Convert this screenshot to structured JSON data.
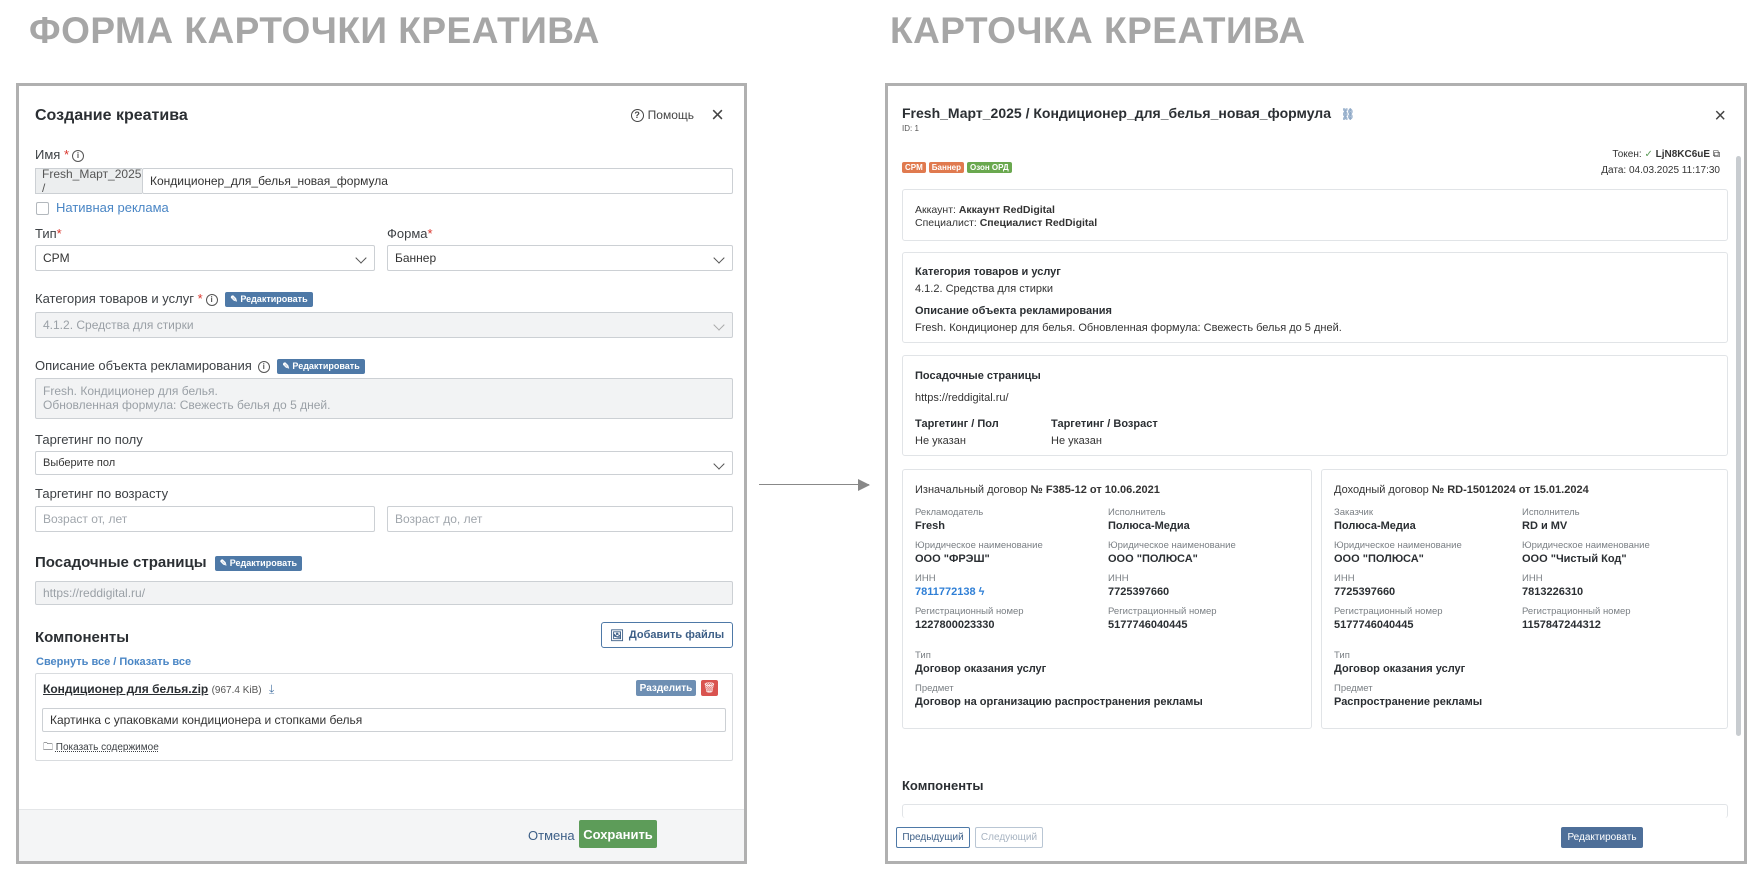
{
  "titles": {
    "form": "ФОРМА КАРТОЧКИ КРЕАТИВА",
    "card": "КАРТОЧКА КРЕАТИВА"
  },
  "form": {
    "title": "Создание креатива",
    "help": "Помощь",
    "name_label": "Имя",
    "name_prefix": "Fresh_Март_2025 /",
    "name_value": "Кондиционер_для_белья_новая_формула",
    "native_label": "Нативная реклама",
    "type_label": "Тип",
    "type_value": "CPM",
    "form_label": "Форма",
    "form_value": "Баннер",
    "category_label": "Категория товаров и услуг",
    "edit_badge": "Редактировать",
    "category_value": "4.1.2. Средства для стирки",
    "description_label": "Описание объекта рекламирования",
    "description_line1": "Fresh. Кондиционер для белья.",
    "description_line2": "Обновленная формула: Свежесть белья до 5 дней.",
    "gender_label": "Таргетинг по полу",
    "gender_placeholder": "Выберите пол",
    "age_label": "Таргетинг по возрасту",
    "age_from_placeholder": "Возраст от, лет",
    "age_to_placeholder": "Возраст до, лет",
    "landing_title": "Посадочные страницы",
    "landing_value": "https://reddigital.ru/",
    "components_title": "Компоненты",
    "add_files": "Добавить файлы",
    "collapse_all": "Свернуть все / Показать все",
    "file_name": "Кондиционер для белья.zip",
    "file_size": "(967.4 KiB)",
    "split_button": "Разделить",
    "file_description": "Картинка с упаковками кондиционера и стопками белья",
    "show_content": "Показать содержимое",
    "cancel": "Отмена",
    "save": "Сохранить"
  },
  "card": {
    "title": "Fresh_Март_2025 / Кондиционер_для_белья_новая_формула",
    "id": "ID: 1",
    "tags": [
      {
        "label": "CPM",
        "color": "#e07a4f"
      },
      {
        "label": "Баннер",
        "color": "#e07a4f"
      },
      {
        "label": "Озон ОРД",
        "color": "#6aa84f"
      }
    ],
    "token_label": "Токен:",
    "token_value": "LjN8KC6uE",
    "date": "Дата: 04.03.2025 11:17:30",
    "account_label": "Аккаунт:",
    "account_value": "Аккаунт RedDigital",
    "specialist_label": "Специалист:",
    "specialist_value": "Специалист RedDigital",
    "category_title": "Категория товаров и услуг",
    "category_value": "4.1.2. Средства для стирки",
    "description_title": "Описание объекта рекламирования",
    "description_value": "Fresh. Кондиционер для белья. Обновленная формула: Свежесть белья до 5 дней.",
    "landing_title": "Посадочные страницы",
    "landing_value": "https://reddigital.ru/",
    "tgt_gender_title": "Таргетинг / Пол",
    "tgt_gender_value": "Не указан",
    "tgt_age_title": "Таргетинг / Возраст",
    "tgt_age_value": "Не указан",
    "contract1": {
      "title_prefix": "Изначальный договор",
      "title_bold": "№ F385-12 от 10.06.2021",
      "advertiser_label": "Рекламодатель",
      "advertiser_value": "Fresh",
      "executor_label": "Исполнитель",
      "executor_value": "Полюса-Медиа",
      "legal_label": "Юридическое наименование",
      "legal_left": "ООО \"ФРЭШ\"",
      "legal_right": "ООО \"ПОЛЮСА\"",
      "inn_label": "ИНН",
      "inn_left": "7811772138",
      "inn_right": "7725397660",
      "reg_label": "Регистрационный номер",
      "reg_left": "1227800023330",
      "reg_right": "5177746040445",
      "type_label": "Тип",
      "type_value": "Договор оказания услуг",
      "subject_label": "Предмет",
      "subject_value": "Договор на организацию распространения рекламы"
    },
    "contract2": {
      "title_prefix": "Доходный договор",
      "title_bold": "№ RD-15012024 от 15.01.2024",
      "customer_label": "Заказчик",
      "customer_value": "Полюса-Медиа",
      "executor_label": "Исполнитель",
      "executor_value": "RD и MV",
      "legal_label": "Юридическое наименование",
      "legal_left": "ООО \"ПОЛЮСА\"",
      "legal_right": "ООО \"Чистый Код\"",
      "inn_label": "ИНН",
      "inn_left": "7725397660",
      "inn_right": "7813226310",
      "reg_label": "Регистрационный номер",
      "reg_left": "5177746040445",
      "reg_right": "1157847244312",
      "type_label": "Тип",
      "type_value": "Договор оказания услуг",
      "subject_label": "Предмет",
      "subject_value": "Распространение рекламы"
    },
    "components_title": "Компоненты",
    "prev": "Предыдущий",
    "next": "Следующий",
    "edit": "Редактировать"
  }
}
